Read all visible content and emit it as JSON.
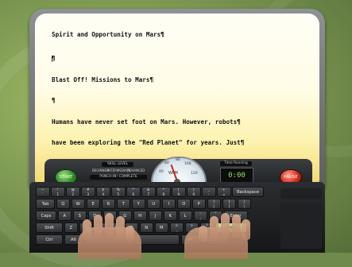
{
  "header": {
    "label": ""
  },
  "document": {
    "lines": [
      "Spirit and Opportunity on Mars¶",
      "¶",
      "Blast Off! Missions to Mars¶",
      "¶",
      "Humans have never set foot on Mars. However, robots¶",
      "have been exploring the \"Red Planet\" for years. Just¶"
    ]
  },
  "controls": {
    "start_label": "START",
    "pause_label": "PAUSE",
    "skill_level_label": "SKILL LEVEL",
    "skill_options": [
      "BEGINNER",
      "INTERMEDIATE",
      "ADVANCED"
    ],
    "punch_label": "PUNCH-IN! COMPLETE",
    "wpm_label": "WPM",
    "gauge_marks": [
      "40",
      "60",
      "80",
      "100",
      "120"
    ],
    "timer_label": "Time Running",
    "timer_value": "0:00",
    "wpm_value": 30
  },
  "keyboard": {
    "row1": [
      "~\n`",
      "!\n1",
      "@\n2",
      "#\n3",
      "$\n4",
      "%\n5",
      "^\n6",
      "&\n7",
      "*\n8",
      "(\n9",
      ")\n0",
      "_\n-",
      "+\n=",
      "Backspace"
    ],
    "row2": [
      "Tab",
      "Q",
      "W",
      "E",
      "R",
      "T",
      "Y",
      "U",
      "I",
      "O",
      "P",
      "{\n[",
      "}\n]",
      "|\n\\"
    ],
    "row3": [
      "Caps Lock",
      "A",
      "S",
      "D",
      "F",
      "G",
      "H",
      "J",
      "K",
      "L",
      ":\n;",
      "\"\n'",
      "Enter"
    ],
    "row4": [
      "Shift",
      "Z",
      "X",
      "C",
      "V",
      "B",
      "N",
      "M",
      "<\n,",
      ">\n.",
      "?\n/",
      "Shift"
    ],
    "row5": [
      "Ctrl",
      "Alt",
      "",
      "Alt",
      "Ctrl"
    ],
    "highlight_key": "Shift",
    "accent": "#a6cf7a"
  }
}
